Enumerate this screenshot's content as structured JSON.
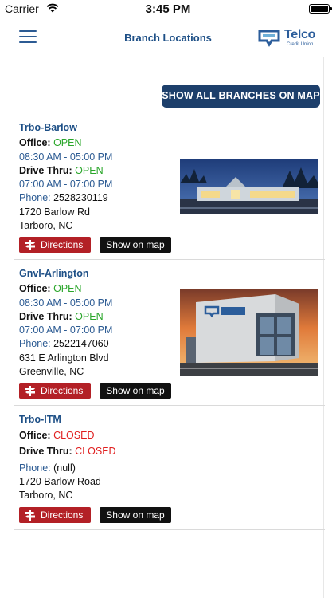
{
  "status_bar": {
    "carrier": "Carrier",
    "time": "3:45 PM"
  },
  "nav": {
    "title": "Branch Locations",
    "logo_name": "Telco",
    "logo_sub": "Credit Union"
  },
  "show_all_label": "SHOW ALL BRANCHES ON MAP",
  "labels": {
    "office": "Office:",
    "drive_thru": "Drive Thru:",
    "phone": "Phone:",
    "directions": "Directions",
    "show_on_map": "Show on map"
  },
  "branches": [
    {
      "name": "Trbo-Barlow",
      "office_status": "OPEN",
      "office_hours": "08:30 AM - 05:00 PM",
      "drive_status": "OPEN",
      "drive_hours": "07:00 AM - 07:00 PM",
      "phone": "2528230119",
      "address1": "1720 Barlow Rd",
      "address2": "Tarboro, NC"
    },
    {
      "name": "Gnvl-Arlington",
      "office_status": "OPEN",
      "office_hours": "08:30 AM - 05:00 PM",
      "drive_status": "OPEN",
      "drive_hours": "07:00 AM - 07:00 PM",
      "phone": "2522147060",
      "address1": "631 E Arlington Blvd",
      "address2": "Greenville, NC"
    },
    {
      "name": "Trbo-ITM",
      "office_status": "CLOSED",
      "drive_status": "CLOSED",
      "phone": "(null)",
      "address1": "1720 Barlow Road",
      "address2": "Tarboro, NC"
    }
  ],
  "colors": {
    "accent": "#1d3f6b",
    "open": "#2aa62a",
    "closed": "#e01e1e",
    "directions": "#b32026",
    "link": "#2c5b93"
  }
}
